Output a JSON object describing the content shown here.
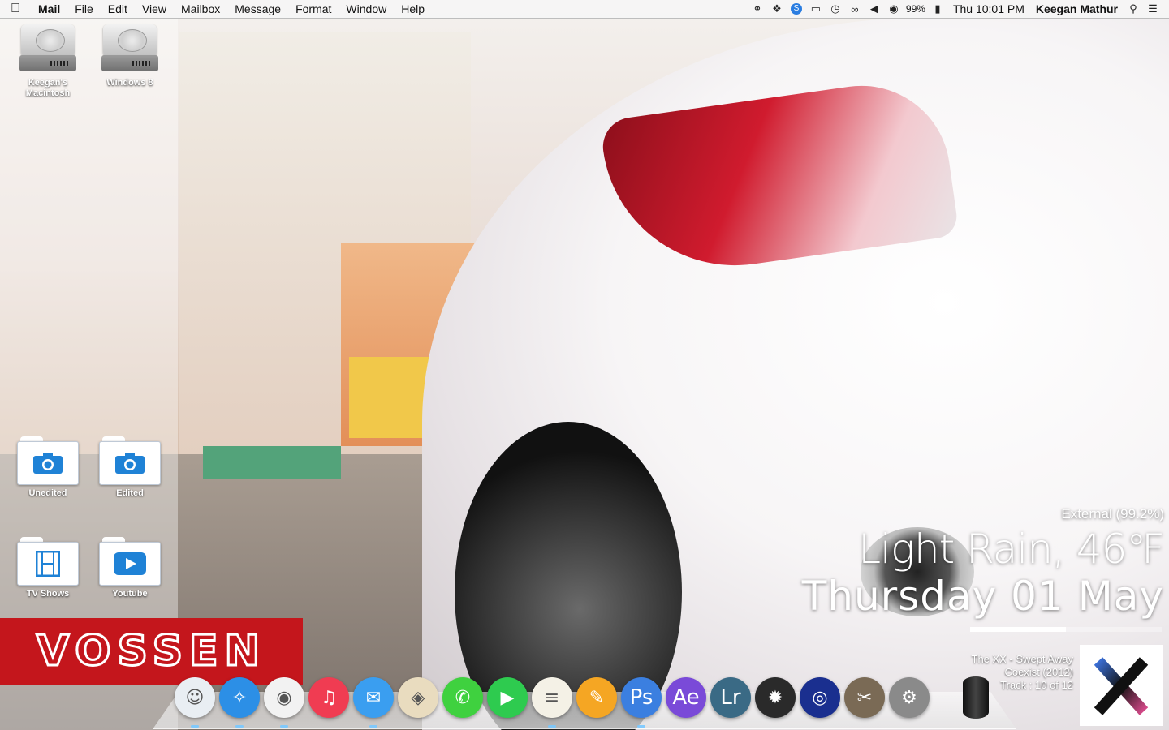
{
  "menubar": {
    "app_name": "Mail",
    "menus": [
      "File",
      "Edit",
      "View",
      "Mailbox",
      "Message",
      "Format",
      "Window",
      "Help"
    ],
    "battery_percent": "99%",
    "clock": "Thu 10:01 PM",
    "user": "Keegan Mathur",
    "status_icons": [
      "headphones-icon",
      "dropbox-icon",
      "shazam-icon",
      "airplay-icon",
      "time-machine-icon",
      "bluetooth-icon",
      "volume-icon",
      "wifi-icon",
      "battery-icon",
      "spotlight-icon",
      "notification-center-icon"
    ]
  },
  "desktop": {
    "drives": [
      {
        "label": "Keegan's Macintosh"
      },
      {
        "label": "Windows 8"
      }
    ],
    "folders": [
      {
        "label": "Unedited",
        "icon": "camera-icon"
      },
      {
        "label": "Edited",
        "icon": "camera-icon"
      },
      {
        "label": "TV Shows",
        "icon": "film-icon"
      },
      {
        "label": "Youtube",
        "icon": "play-icon"
      }
    ]
  },
  "logo": {
    "text": "VOSSEN",
    "color": "#c4161c"
  },
  "widgets": {
    "disk_status": "External (99.2%)",
    "weather": "Light Rain, 46℉",
    "date": "Thursday 01 May",
    "track_progress": 0.5,
    "track": {
      "line1": "The XX - Swept Away",
      "line2": "Coexist (2012)",
      "line3": "Track : 10 of 12"
    }
  },
  "dock": {
    "items": [
      {
        "name": "finder",
        "color": "#e9eef3",
        "glyph": "☺",
        "running": true
      },
      {
        "name": "safari",
        "color": "#2c8fe6",
        "glyph": "✧",
        "running": true
      },
      {
        "name": "chrome",
        "color": "#f2f2f2",
        "glyph": "◉",
        "running": true
      },
      {
        "name": "itunes",
        "color": "#f03c52",
        "glyph": "♫",
        "running": false
      },
      {
        "name": "mail",
        "color": "#3a9ef0",
        "glyph": "✉",
        "running": true
      },
      {
        "name": "maps",
        "color": "#e9dcbf",
        "glyph": "◈",
        "running": false
      },
      {
        "name": "messages",
        "color": "#3fd13f",
        "glyph": "✆",
        "running": false
      },
      {
        "name": "facetime",
        "color": "#2ecb4f",
        "glyph": "▶",
        "running": false
      },
      {
        "name": "notes",
        "color": "#f4f1e6",
        "glyph": "≡",
        "running": true
      },
      {
        "name": "pages",
        "color": "#f5a623",
        "glyph": "✎",
        "running": false
      },
      {
        "name": "photoshop",
        "color": "#3b7fe0",
        "glyph": "Ps",
        "running": true
      },
      {
        "name": "after-effects",
        "color": "#7a4ad8",
        "glyph": "Ae",
        "running": false
      },
      {
        "name": "lightroom",
        "color": "#3a6a85",
        "glyph": "Lr",
        "running": false
      },
      {
        "name": "final-cut",
        "color": "#2a2a2a",
        "glyph": "✹",
        "running": false
      },
      {
        "name": "audio-app",
        "color": "#1a2f8f",
        "glyph": "◎",
        "running": false
      },
      {
        "name": "gimp",
        "color": "#7a6a55",
        "glyph": "✂",
        "running": false
      },
      {
        "name": "system-preferences",
        "color": "#8a8a8a",
        "glyph": "⚙",
        "running": false
      }
    ]
  }
}
